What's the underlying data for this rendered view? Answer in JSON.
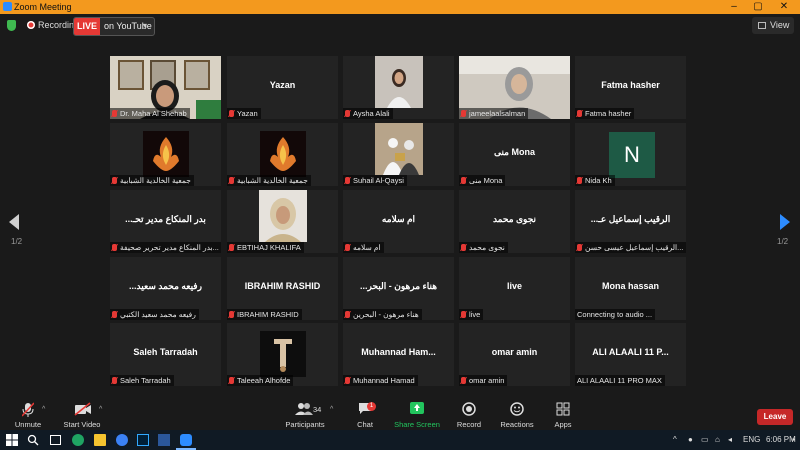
{
  "window": {
    "title": "Zoom Meeting",
    "minimize": "–",
    "maximize": "▢",
    "close": "✕"
  },
  "topbar": {
    "recording_label": "Recording",
    "live_badge": "LIVE",
    "live_target": "on YouTube",
    "view_label": "View"
  },
  "tiles": [
    {
      "label": "Dr. Maha Al Shehab",
      "name": "",
      "type": "video",
      "active": true
    },
    {
      "label": "Yazan",
      "name": "Yazan",
      "type": "name"
    },
    {
      "label": "Aysha Alali",
      "name": "",
      "type": "video"
    },
    {
      "label": "jameelaalsalman",
      "name": "",
      "type": "video"
    },
    {
      "label": "Fatma hasher",
      "name": "Fatma hasher",
      "type": "name"
    },
    {
      "label": "جمعية الخالدية الشبابية",
      "name": "",
      "type": "logo"
    },
    {
      "label": "جمعية الخالدية الشبابية",
      "name": "",
      "type": "logo"
    },
    {
      "label": "Suhail Al-Qaysi",
      "name": "",
      "type": "video"
    },
    {
      "label": "منى Mona",
      "name": "منى Mona",
      "type": "name"
    },
    {
      "label": "Nida Kh",
      "name": "N",
      "type": "avatar"
    },
    {
      "label": "بدر المنكاع مدير تحرير صحيفة...",
      "name": "...بدر المنكاع مدير تحـ",
      "type": "name"
    },
    {
      "label": "EBTIHAJ KHALIFA",
      "name": "",
      "type": "video"
    },
    {
      "label": "ام سلامه",
      "name": "ام سلامه",
      "type": "name"
    },
    {
      "label": "نجوى محمد",
      "name": "نجوى محمد",
      "type": "name"
    },
    {
      "label": "الرقيب إسماعيل عيسى حسن...",
      "name": "...الرقيب إسماعيل عـ",
      "type": "name"
    },
    {
      "label": "رفيعه محمد سعيد الكتبي",
      "name": "...رفيعه محمد سعيد",
      "type": "name"
    },
    {
      "label": "IBRAHIM RASHID",
      "name": "IBRAHIM RASHID",
      "type": "name"
    },
    {
      "label": "هناء مرهون - البحرين",
      "name": "...هناء مرهون - البحر",
      "type": "name"
    },
    {
      "label": "live",
      "name": "live",
      "type": "name"
    },
    {
      "label": "Connecting to audio ...",
      "name": "Mona hassan",
      "type": "name",
      "nomic": true
    },
    {
      "label": "Saleh Tarradah",
      "name": "Saleh Tarradah",
      "type": "name"
    },
    {
      "label": "Taleeah Alhofde",
      "name": "",
      "type": "logo2"
    },
    {
      "label": "Muhannad Hamad",
      "name": "Muhannad Ham...",
      "type": "name"
    },
    {
      "label": "omar amin",
      "name": "omar amin",
      "type": "name"
    },
    {
      "label": "ALI ALAALI 11 PRO MAX",
      "name": "ALI ALAALI 11 P...",
      "type": "name",
      "nomic": true
    }
  ],
  "pager": {
    "left": "1/2",
    "right": "1/2"
  },
  "toolbar": {
    "unmute": "Unmute",
    "start_video": "Start Video",
    "participants": "Participants",
    "participants_count": "34",
    "chat": "Chat",
    "chat_badge": "1",
    "share_screen": "Share Screen",
    "record": "Record",
    "reactions": "Reactions",
    "apps": "Apps",
    "leave": "Leave"
  },
  "colors": {
    "title_bar": "#f3991e",
    "accent_blue": "#2d8cff",
    "share_green": "#22c55e",
    "leave_red": "#c62828",
    "active_border": "#d6e86a"
  },
  "taskbar": {
    "lang": "ENG",
    "time": "6:06 PM"
  }
}
